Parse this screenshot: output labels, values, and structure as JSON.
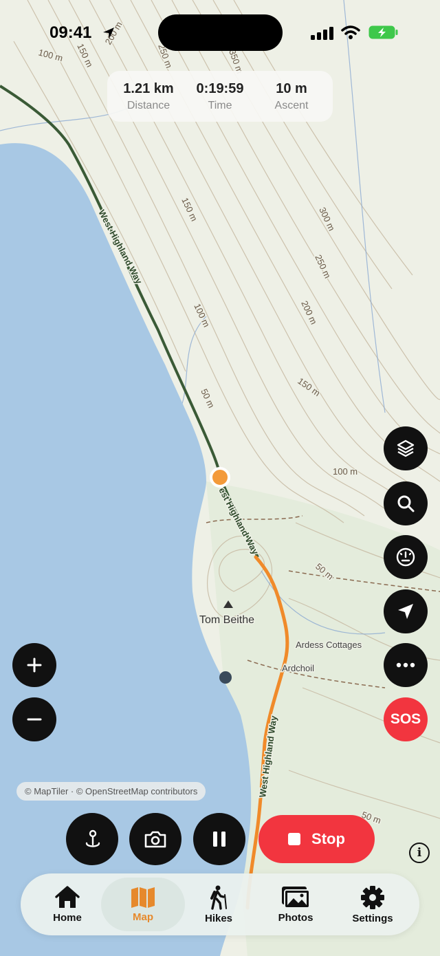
{
  "status_bar": {
    "time": "09:41"
  },
  "stats": [
    {
      "value": "1.21 km",
      "label": "Distance"
    },
    {
      "value": "0:19:59",
      "label": "Time"
    },
    {
      "value": "10 m",
      "label": "Ascent"
    }
  ],
  "map": {
    "trail_label": "West Highland Way",
    "trail_label_lower": "est Highland Way",
    "contour_labels": [
      "100 m",
      "150 m",
      "200 m",
      "250 m",
      "350 m",
      "300 m",
      "250 m",
      "200 m",
      "150 m",
      "100 m",
      "50 m",
      "150 m",
      "100 m",
      "50 m",
      "50 m"
    ],
    "places": {
      "peak": "Tom Beithe",
      "cottages": "Ardess Cottages",
      "hamlet": "Ardchoil"
    },
    "attribution": "© MapTiler · © OpenStreetMap contributors",
    "colors": {
      "water": "#a8c8e4",
      "land": "#eef0e6",
      "trail": "#3a5a36",
      "track": "#f08a2a",
      "contour": "#bfae94"
    }
  },
  "map_buttons": {
    "layers": "layers-icon",
    "search": "search-icon",
    "speedometer": "gauge-icon",
    "locate": "location-arrow-icon",
    "more": "more-icon",
    "sos": "SOS"
  },
  "zoom": {
    "in": "+",
    "out": "−"
  },
  "recording": {
    "stop_label": "Stop"
  },
  "info_label": "i",
  "tabs": [
    {
      "label": "Home",
      "icon": "home-icon"
    },
    {
      "label": "Map",
      "icon": "map-icon",
      "active": true
    },
    {
      "label": "Hikes",
      "icon": "hiker-icon"
    },
    {
      "label": "Photos",
      "icon": "photos-icon"
    },
    {
      "label": "Settings",
      "icon": "gear-icon"
    }
  ]
}
